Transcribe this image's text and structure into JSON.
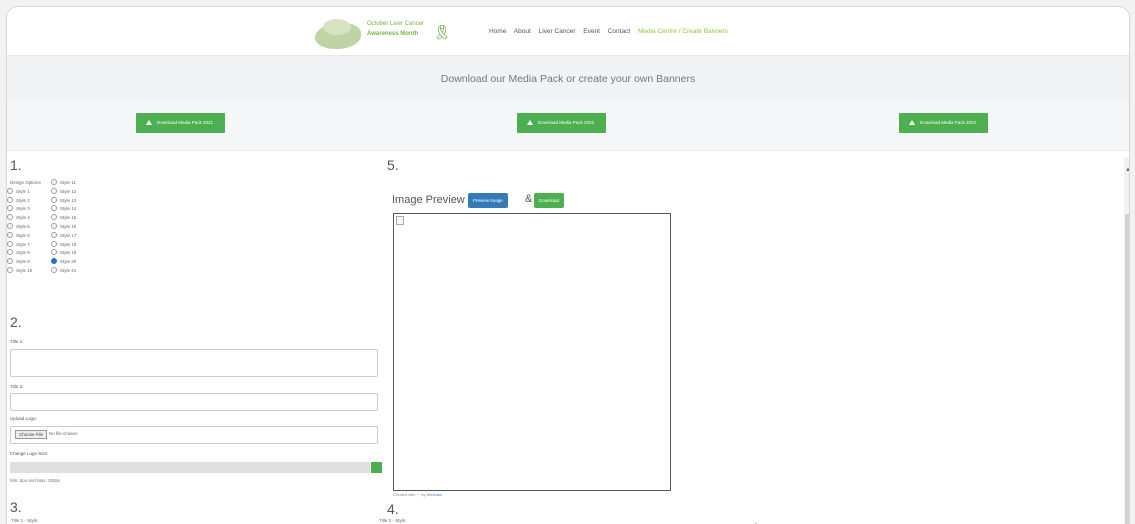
{
  "header": {
    "logo_line1": "October Liver Cancer",
    "logo_line2": "Awareness Month",
    "nav": [
      "Home",
      "About",
      "Liver Cancer",
      "Event",
      "Contact",
      "Media Centre / Create Banners"
    ]
  },
  "banner": {
    "title": "Download our Media Pack or create your own Banners"
  },
  "downloads": [
    "Download Media Pack 2021",
    "Download Media Pack 2022",
    "Download Media Pack 2023"
  ],
  "section1": {
    "num": "1.",
    "label": "Design Options",
    "styles_col1": [
      "Style 1",
      "Style 2",
      "Style 3",
      "Style 4",
      "Style 5",
      "Style 6",
      "Style 7",
      "Style 8",
      "Style 9",
      "Style 10"
    ],
    "styles_col2": [
      "Style 11",
      "Style 12",
      "Style 13",
      "Style 14",
      "Style 15",
      "Style 16",
      "Style 17",
      "Style 18",
      "Style 19",
      "Style 20",
      "Style 21"
    ],
    "selected": "Style 20"
  },
  "section2": {
    "num": "2.",
    "title1_label": "Title 1:",
    "title2_label": "Title 2:",
    "upload_label": "Upload Logo:",
    "choose_file": "Choose File",
    "no_file": "No file chosen",
    "size_label": "Change Logo Size:",
    "size_hint": "Min: 5px and Max: 250px"
  },
  "section3": {
    "num": "3.",
    "field_label": "Title 1 - Style:"
  },
  "section4": {
    "num": "4.",
    "field_label": "Title 2 - Style:"
  },
  "section5": {
    "num": "5.",
    "preview_title": "Image Preview",
    "preview_btn": "Preview Image",
    "amp": "&",
    "download_btn": "Download",
    "credit_prefix": "Created with",
    "credit_by": "by",
    "credit_link": "Webcam"
  },
  "colors": {
    "green": "#4caf50",
    "blue": "#337ab7",
    "nav_active": "#8dc63f"
  }
}
